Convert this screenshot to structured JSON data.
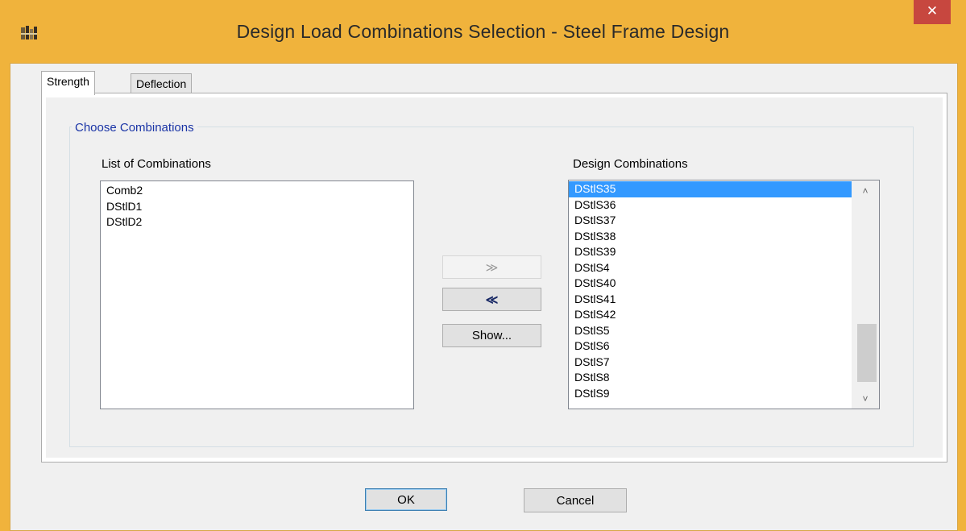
{
  "window": {
    "title": "Design Load Combinations Selection - Steel Frame Design",
    "close_glyph": "✕",
    "icon": "etabs-app-icon"
  },
  "tabs": [
    {
      "label": "Strength",
      "active": true
    },
    {
      "label": "Deflection",
      "active": false
    }
  ],
  "group": {
    "caption": "Choose Combinations"
  },
  "left_list": {
    "label": "List of Combinations",
    "items": [
      "Comb2",
      "DStlD1",
      "DStlD2"
    ]
  },
  "right_list": {
    "label": "Design Combinations",
    "items": [
      "DStlS35",
      "DStlS36",
      "DStlS37",
      "DStlS38",
      "DStlS39",
      "DStlS4",
      "DStlS40",
      "DStlS41",
      "DStlS42",
      "DStlS5",
      "DStlS6",
      "DStlS7",
      "DStlS8",
      "DStlS9"
    ],
    "selected": "DStlS35"
  },
  "buttons": {
    "add": "≫",
    "remove": "≪",
    "show": "Show...",
    "ok": "OK",
    "cancel": "Cancel"
  },
  "colors": {
    "frame": "#F0B33C",
    "close": "#C7473F",
    "selection": "#3399FF",
    "group_caption": "#1A34A6"
  }
}
